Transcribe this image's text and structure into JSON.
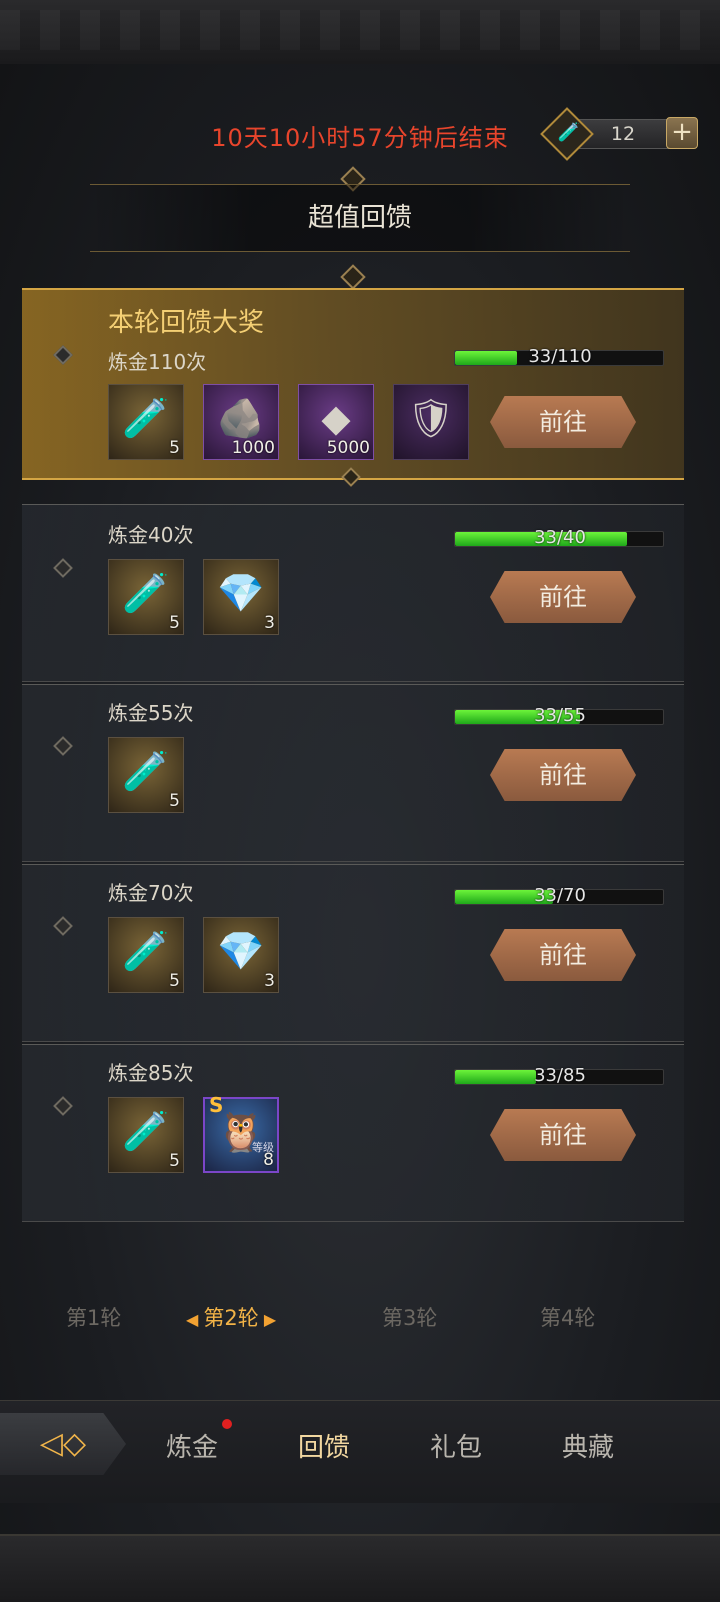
{
  "header": {
    "countdown": "10天10小时57分钟后结束",
    "currency": {
      "icon": "potion-icon",
      "amount": "12"
    },
    "section_title": "超值回馈"
  },
  "rewards": [
    {
      "grand_title": "本轮回馈大奖",
      "requirement": "炼金110次",
      "progress_text": "33/110",
      "progress_ratio": 0.3,
      "items": [
        {
          "icon": "potion-icon",
          "count": "5",
          "rarity": "gold"
        },
        {
          "icon": "ore-icon",
          "count": "1000",
          "rarity": "purple"
        },
        {
          "icon": "stone-icon",
          "count": "5000",
          "rarity": "purple"
        },
        {
          "icon": "armor-icon",
          "count": "",
          "rarity": "purple"
        }
      ],
      "button": "前往"
    },
    {
      "requirement": "炼金40次",
      "progress_text": "33/40",
      "progress_ratio": 0.825,
      "items": [
        {
          "icon": "potion-icon",
          "count": "5",
          "rarity": "gold"
        },
        {
          "icon": "crystal-icon",
          "count": "3",
          "rarity": "gold"
        }
      ],
      "button": "前往"
    },
    {
      "requirement": "炼金55次",
      "progress_text": "33/55",
      "progress_ratio": 0.6,
      "items": [
        {
          "icon": "potion-icon",
          "count": "5",
          "rarity": "gold"
        }
      ],
      "button": "前往"
    },
    {
      "requirement": "炼金70次",
      "progress_text": "33/70",
      "progress_ratio": 0.471,
      "items": [
        {
          "icon": "potion-icon",
          "count": "5",
          "rarity": "gold"
        },
        {
          "icon": "crystal-icon",
          "count": "3",
          "rarity": "gold"
        }
      ],
      "button": "前往"
    },
    {
      "requirement": "炼金85次",
      "progress_text": "33/85",
      "progress_ratio": 0.388,
      "items": [
        {
          "icon": "potion-icon",
          "count": "5",
          "rarity": "gold"
        },
        {
          "icon": "beast-icon",
          "count": "8",
          "rarity": "blue",
          "badge": "S",
          "level_label": "等级"
        }
      ],
      "button": "前往"
    }
  ],
  "rounds": {
    "items": [
      "第1轮",
      "第2轮",
      "第3轮",
      "第4轮"
    ],
    "active": "第2轮"
  },
  "bottom_nav": {
    "back_icon": "back-arrow-icon",
    "tabs": [
      "炼金",
      "回馈",
      "礼包",
      "典藏"
    ],
    "active": "回馈",
    "notification_tab": "炼金"
  }
}
